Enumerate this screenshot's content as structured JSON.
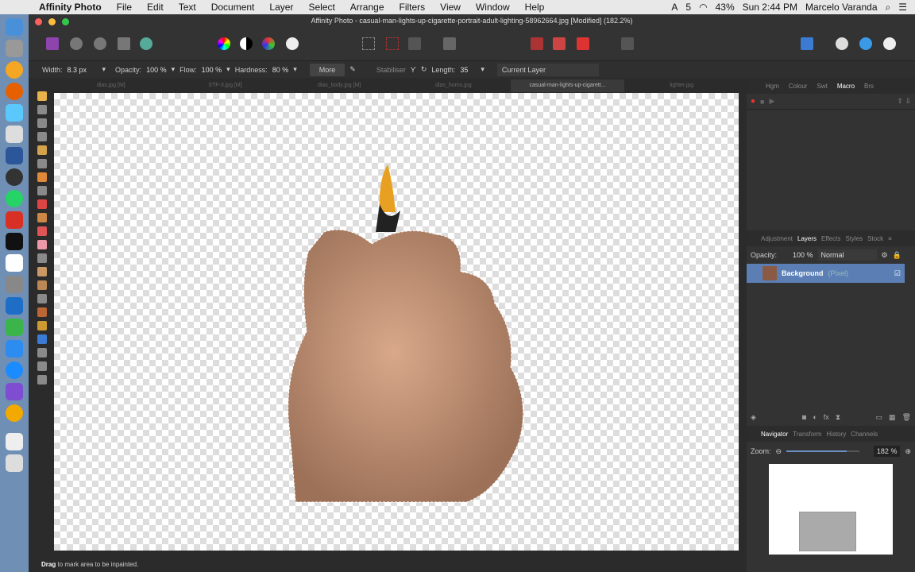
{
  "menubar": {
    "app": "Affinity Photo",
    "items": [
      "File",
      "Edit",
      "Text",
      "Document",
      "Layer",
      "Select",
      "Arrange",
      "Filters",
      "View",
      "Window",
      "Help"
    ],
    "battery": "43%",
    "adobe_count": "5",
    "clock": "Sun 2:44 PM",
    "user": "Marcelo Varanda"
  },
  "window": {
    "title": "Affinity Photo - casual-man-lights-up-cigarette-portrait-adult-lighting-58962664.jpg [Modified] (182.2%)"
  },
  "context": {
    "width_label": "Width:",
    "width": "8.3 px",
    "opacity_label": "Opacity:",
    "opacity": "100 %",
    "flow_label": "Flow:",
    "flow": "100 %",
    "hardness_label": "Hardness:",
    "hardness": "80 %",
    "more": "More",
    "stabiliser": "Stabiliser",
    "length_label": "Length:",
    "length": "35",
    "source": "Current Layer"
  },
  "doc_tabs": [
    "dias.jpg [M]",
    "STF-3.jpg [M]",
    "dias_body.jpg [M]",
    "dias_horns.jpg",
    "casual-man-lights-up-cigarett...",
    "lighter.jpg"
  ],
  "top_panel": {
    "tabs": [
      "Hgm",
      "Colour",
      "Swt",
      "Macro",
      "Brs"
    ],
    "active": "Macro"
  },
  "layers_panel": {
    "tabs": [
      "Adjustment",
      "Layers",
      "Effects",
      "Styles",
      "Stock"
    ],
    "active": "Layers",
    "opacity_label": "Opacity:",
    "opacity": "100 %",
    "blend": "Normal",
    "layer": {
      "name": "Background",
      "type": "(Pixel)"
    }
  },
  "nav_panel": {
    "tabs": [
      "Navigator",
      "Transform",
      "History",
      "Channels"
    ],
    "active": "Navigator",
    "zoom_label": "Zoom:",
    "zoom": "182 %",
    "zoom_fraction": 0.82
  },
  "status": {
    "bold": "Drag",
    "text": " to mark area to be inpainted."
  }
}
